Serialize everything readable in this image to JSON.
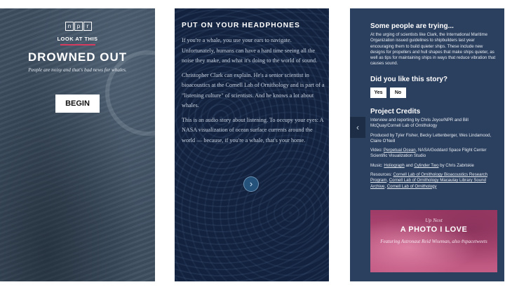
{
  "screen1": {
    "npr_letters": [
      "n",
      "p",
      "r"
    ],
    "eyebrow": "LOOK AT THIS",
    "title": "DROWNED OUT",
    "subtitle": "People are noisy and that's bad news for whales.",
    "begin_label": "BEGIN",
    "accent_color": "#d63a5e"
  },
  "screen2": {
    "title": "PUT ON YOUR HEADPHONES",
    "paragraphs": [
      "If you're a whale, you use your ears to navigate. Unfortunately, humans can have a hard time seeing all the noise they make, and what it's doing to the world of sound.",
      "Christopher Clark can explain. He's a senior scientist in bioacoustics at the Cornell Lab of Ornithology and is part of a \"listening culture\" of scientists. And he knows a lot about whales.",
      "This is an audio story about listening. To occupy your eyes: A NASA visualization of ocean surface currents around the world — because, if you're a whale, that's your home."
    ],
    "next_icon": "chevron-right-icon"
  },
  "screen3": {
    "heading": "Some people are trying...",
    "body": "At the urging of scientists like Clark, the International Maritime Organization issued guidelines to shipbuilders last year encouraging them to build quieter ships. These include new designs for propellers and hull shapes that make ships quieter, as well as tips for maintaining ships in ways that reduce vibration that causes sound.",
    "question": "Did you like this story?",
    "yes_label": "Yes",
    "no_label": "No",
    "credits_heading": "Project Credits",
    "credit_reporting": "Interview and reporting by Chris Joyce/NPR and Bill McQuay/Cornell Lab of Ornithology",
    "credit_produced": "Produced by Tyler Fisher, Becky Lettenberger, Wes Lindamood, Claire O'Neill",
    "video_prefix": "Video: ",
    "video_link": "Perpetual Ocean",
    "video_suffix": ", NASA/Goddard Space Flight Center Scientific Visualization Studio",
    "music_prefix": "Music: ",
    "music_link1": "Holiograph",
    "music_and": " and ",
    "music_link2": "Cylinder Two",
    "music_suffix": " by Chris Zabriskie",
    "resources_prefix": "Resources: ",
    "resource_link1": "Cornell Lab of Ornithology Bioacoustics Research Program",
    "resource_sep1": ", ",
    "resource_link2": "Cornell Lab of Ornithology Macaulay Library Sound Archive",
    "resource_sep2": ", ",
    "resource_link3": "Cornell Lab of Ornithology",
    "back_icon": "chevron-left-icon",
    "upnext": {
      "label": "Up Next",
      "title": "A PHOTO I LOVE",
      "subtitle": "Featuring Astronaut Reid Wiseman, also #spacetweets"
    }
  }
}
